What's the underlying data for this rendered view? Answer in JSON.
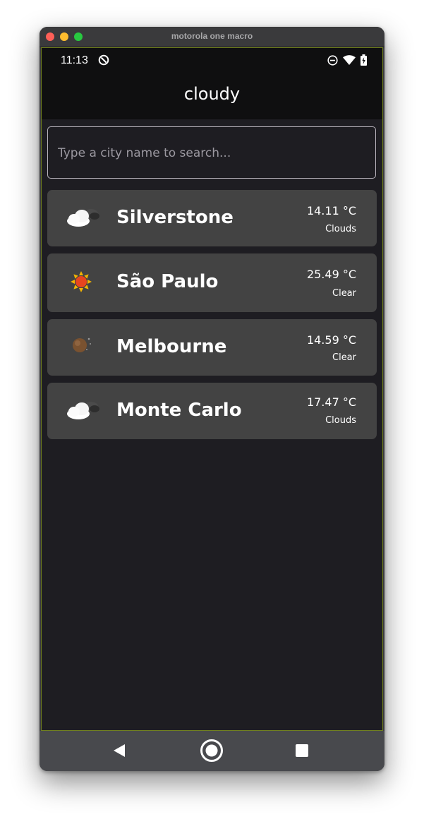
{
  "window": {
    "title": "motorola one macro"
  },
  "status_bar": {
    "time": "11:13",
    "icons": [
      "data-saver-icon",
      "do-not-disturb-icon",
      "wifi-icon",
      "battery-charging-icon"
    ]
  },
  "app": {
    "title": "cloudy"
  },
  "search": {
    "placeholder": "Type a city name to search...",
    "value": ""
  },
  "cities": [
    {
      "name": "Silverstone",
      "temp": "14.11 °C",
      "condition": "Clouds",
      "icon": "cloud-icon"
    },
    {
      "name": "São Paulo",
      "temp": "25.49 °C",
      "condition": "Clear",
      "icon": "sun-icon"
    },
    {
      "name": "Melbourne",
      "temp": "14.59 °C",
      "condition": "Clear",
      "icon": "moon-icon"
    },
    {
      "name": "Monte Carlo",
      "temp": "17.47 °C",
      "condition": "Clouds",
      "icon": "cloud-icon"
    }
  ],
  "nav": {
    "buttons": [
      "back-icon",
      "home-icon",
      "recents-icon"
    ]
  },
  "colors": {
    "header": "#0f0f10",
    "background": "#1e1d22",
    "card": "#434343",
    "navbar": "#48494d",
    "accent_border": "#6f7f1e"
  }
}
